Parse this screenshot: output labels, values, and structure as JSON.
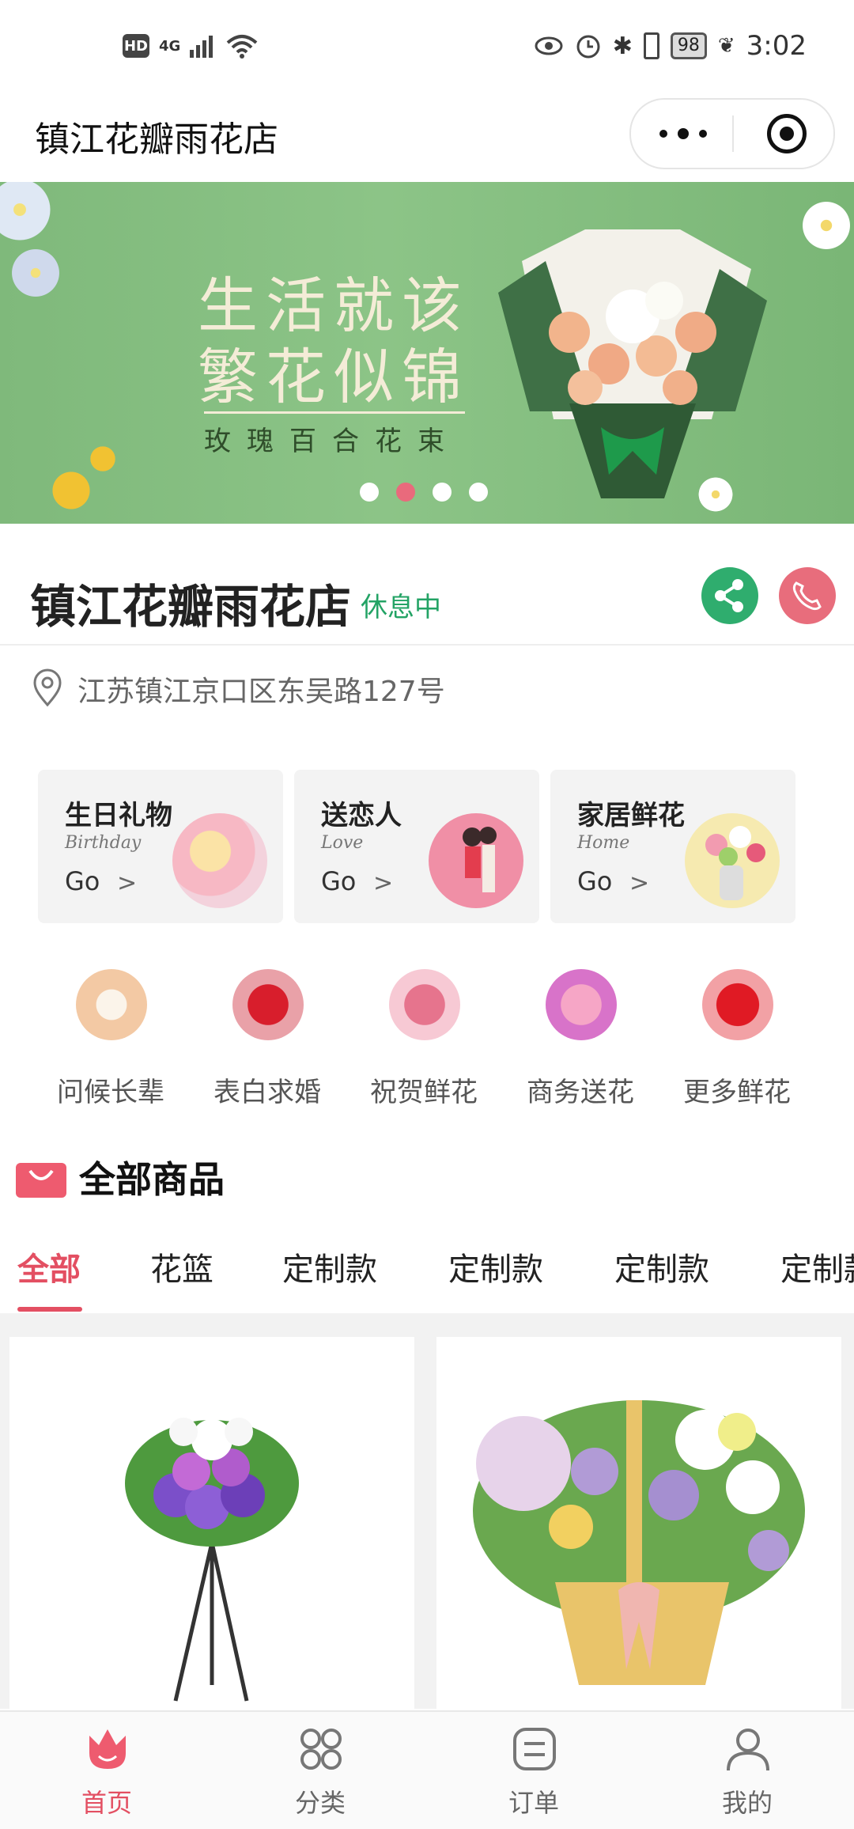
{
  "status_bar": {
    "hd": "HD",
    "network": "4G",
    "battery": "98",
    "time": "3:02"
  },
  "title_bar": {
    "title": "镇江花瓣雨花店"
  },
  "banner": {
    "line1": "生活就该",
    "line2": "繁花似锦",
    "line3": "玫瑰百合花束",
    "dots": 4,
    "active_dot": 1
  },
  "shop": {
    "name": "镇江花瓣雨花店",
    "status": "休息中",
    "address": "江苏镇江京口区东吴路127号"
  },
  "cards": [
    {
      "title": "生日礼物",
      "subtitle": "Birthday",
      "go": "Go"
    },
    {
      "title": "送恋人",
      "subtitle": "Love",
      "go": "Go"
    },
    {
      "title": "家居鲜花",
      "subtitle": "Home",
      "go": "Go"
    }
  ],
  "round_categories": [
    {
      "label": "问候长辈"
    },
    {
      "label": "表白求婚"
    },
    {
      "label": "祝贺鲜花"
    },
    {
      "label": "商务送花"
    },
    {
      "label": "更多鲜花"
    }
  ],
  "products_section": {
    "title": "全部商品",
    "tabs": [
      "全部",
      "花篮",
      "定制款",
      "定制款",
      "定制款",
      "定制款"
    ]
  },
  "nav": [
    {
      "label": "首页"
    },
    {
      "label": "分类"
    },
    {
      "label": "订单"
    },
    {
      "label": "我的"
    }
  ],
  "colors": {
    "accent": "#e34f62",
    "status_green": "#23a365",
    "share_green": "#2fad6e",
    "phone_red": "#e86d7c"
  }
}
